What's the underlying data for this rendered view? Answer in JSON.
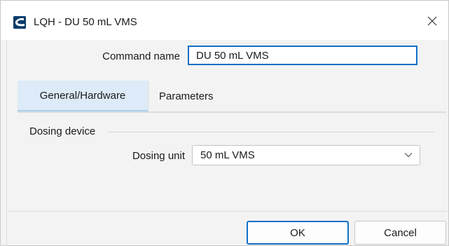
{
  "window": {
    "title": "LQH - DU 50 mL VMS",
    "close_icon": "close-icon",
    "app_icon": "app-logo-icon"
  },
  "command": {
    "label": "Command name",
    "value": "DU 50 mL VMS"
  },
  "tabs": [
    {
      "label": "General/Hardware",
      "selected": true
    },
    {
      "label": "Parameters",
      "selected": false
    }
  ],
  "group": {
    "title": "Dosing device",
    "unit_label": "Dosing unit",
    "unit_value": "50 mL VMS"
  },
  "buttons": {
    "ok": "OK",
    "cancel": "Cancel"
  },
  "colors": {
    "accent": "#0f6fc6",
    "tab_selected_bg": "#dcebf7"
  }
}
